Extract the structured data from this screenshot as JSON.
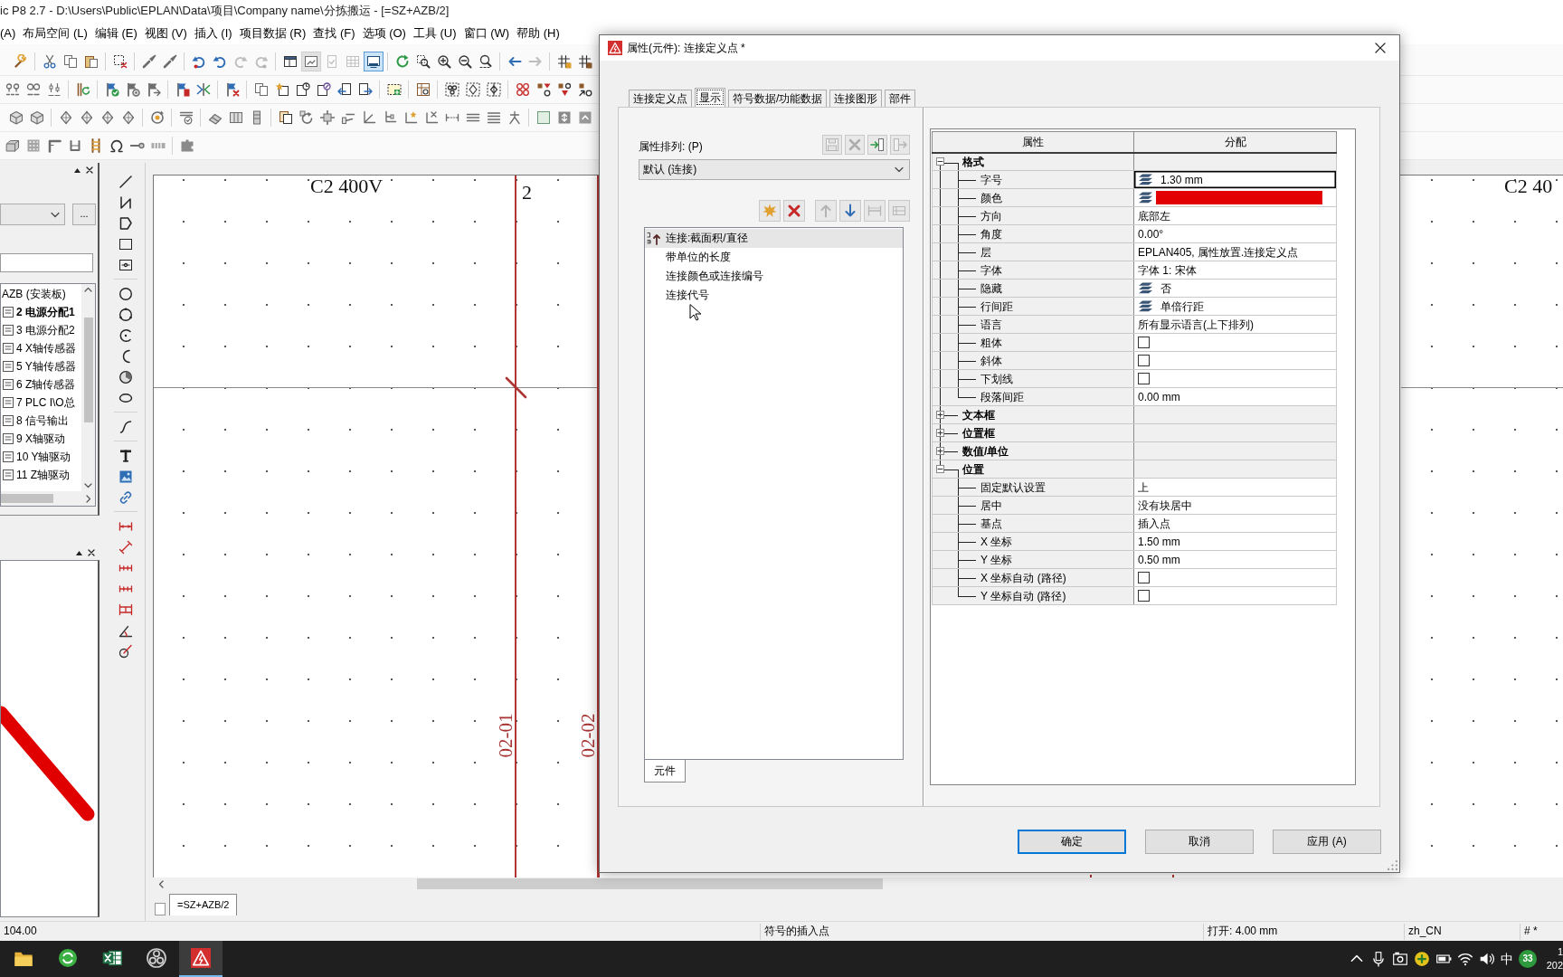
{
  "window": {
    "title": "ic P8 2.7 - D:\\Users\\Public\\EPLAN\\Data\\项目\\Company name\\分拣搬运 - [=SZ+AZB/2]"
  },
  "menu": [
    "(A)",
    "布局空间 (L)",
    "编辑 (E)",
    "视图 (V)",
    "插入 (I)",
    "项目数据 (R)",
    "查找 (F)",
    "选项 (O)",
    "工具 (U)",
    "窗口 (W)",
    "帮助 (H)"
  ],
  "toolbars": [
    [
      [
        {
          "kind": "wrench"
        }
      ],
      [
        {
          "kind": "scissors"
        },
        {
          "kind": "copy"
        },
        {
          "kind": "paste"
        }
      ],
      [
        {
          "kind": "deselect"
        }
      ],
      [
        {
          "kind": "brush"
        },
        {
          "kind": "brush"
        }
      ],
      [
        {
          "kind": "undomark",
          "disabled": false
        },
        {
          "kind": "undo",
          "disabled": false
        },
        {
          "kind": "redo",
          "disabled": true
        },
        {
          "kind": "redomark",
          "disabled": true
        }
      ],
      [
        {
          "kind": "layout",
          "disabled": false,
          "pressed": false,
          "hovered": false
        },
        {
          "kind": "view",
          "disabled": false,
          "pressed": false,
          "hovered": true
        },
        {
          "kind": "checkdoc",
          "disabled": true,
          "pressed": false,
          "hovered": false
        },
        {
          "kind": "table",
          "disabled": true,
          "pressed": false,
          "hovered": false
        },
        {
          "kind": "monitor",
          "disabled": false,
          "pressed": true,
          "hovered": false
        }
      ],
      [
        {
          "kind": "refresh"
        },
        {
          "kind": "zoomwindow"
        },
        {
          "kind": "zoomin"
        },
        {
          "kind": "zoomout"
        },
        {
          "kind": "zoomfit"
        }
      ],
      [
        {
          "kind": "back",
          "disabled": false
        },
        {
          "kind": "forward",
          "disabled": true
        }
      ],
      [
        {
          "kind": "hasha"
        },
        {
          "kind": "hashb"
        }
      ]
    ],
    [
      [
        {
          "kind": "numbering"
        },
        {
          "kind": "numbering2"
        },
        {
          "kind": "numbering3"
        }
      ],
      [
        {
          "kind": "barsync"
        }
      ],
      [
        {
          "kind": "flagcheck"
        },
        {
          "kind": "flaggear"
        },
        {
          "kind": "flagarrow"
        }
      ],
      [
        {
          "kind": "flagbook"
        },
        {
          "kind": "merge"
        }
      ],
      [
        {
          "kind": "flagx"
        }
      ],
      [
        {
          "kind": "pages"
        },
        {
          "kind": "pagestar"
        },
        {
          "kind": "pageclock"
        },
        {
          "kind": "pageout"
        },
        {
          "kind": "pageleft"
        },
        {
          "kind": "pageright"
        }
      ],
      [
        {
          "kind": "boxplus"
        }
      ],
      [
        {
          "kind": "gridsym"
        }
      ],
      [
        {
          "kind": "dashcircles"
        },
        {
          "kind": "dashdiamond"
        },
        {
          "kind": "dashnode"
        }
      ],
      [
        {
          "kind": "chains"
        },
        {
          "kind": "filter"
        },
        {
          "kind": "filter2"
        },
        {
          "kind": "filter3"
        }
      ]
    ],
    [
      [
        {
          "kind": "cube"
        },
        {
          "kind": "cube"
        }
      ],
      [
        {
          "kind": "gem"
        },
        {
          "kind": "gem"
        },
        {
          "kind": "gem"
        },
        {
          "kind": "gem"
        }
      ],
      [
        {
          "kind": "rotate"
        }
      ],
      [
        {
          "kind": "stackcheck"
        }
      ],
      [
        {
          "kind": "eraser"
        },
        {
          "kind": "columns"
        },
        {
          "kind": "column"
        }
      ],
      [
        {
          "kind": "docstack"
        },
        {
          "kind": "rotatearrow"
        },
        {
          "kind": "gearsq"
        },
        {
          "kind": "slant"
        },
        {
          "kind": "angle"
        },
        {
          "kind": "angle2"
        },
        {
          "kind": "starangle"
        },
        {
          "kind": "xangle"
        },
        {
          "kind": "dimline"
        },
        {
          "kind": "lines3"
        },
        {
          "kind": "lines4"
        },
        {
          "kind": "junction"
        }
      ],
      [
        {
          "kind": "squaregreen"
        },
        {
          "kind": "squarearrows"
        },
        {
          "kind": "squaregray"
        }
      ]
    ],
    [
      [
        {
          "kind": "block"
        },
        {
          "kind": "dotgrid"
        },
        {
          "kind": "corner"
        },
        {
          "kind": "ushape"
        },
        {
          "kind": "ladder"
        },
        {
          "kind": "omega"
        },
        {
          "kind": "terminal"
        },
        {
          "kind": "stripe"
        }
      ],
      [
        {
          "kind": "puzzle"
        }
      ]
    ]
  ],
  "navigator": {
    "more_button": "...",
    "tree": [
      {
        "label": "AZB (安装板)",
        "selected": false,
        "children": [
          {
            "label": "2 电源分配1",
            "selected": true
          },
          {
            "label": "3 电源分配2",
            "selected": false
          },
          {
            "label": "4 X轴传感器",
            "selected": false
          },
          {
            "label": "5 Y轴传感器",
            "selected": false
          },
          {
            "label": "6 Z轴传感器",
            "selected": false
          },
          {
            "label": "7 PLC I\\O总",
            "selected": false
          },
          {
            "label": "8 信号输出",
            "selected": false
          },
          {
            "label": "9 X轴驱动",
            "selected": false
          },
          {
            "label": "10 Y轴驱动",
            "selected": false
          },
          {
            "label": "11 Z轴驱动",
            "selected": false
          }
        ]
      }
    ]
  },
  "draw_toolbar": [
    [
      {
        "kind": "line"
      },
      {
        "kind": "polyline"
      },
      {
        "kind": "polygon"
      },
      {
        "kind": "rect"
      },
      {
        "kind": "framerect"
      }
    ],
    [
      {
        "kind": "circle"
      },
      {
        "kind": "circle3"
      },
      {
        "kind": "arc"
      },
      {
        "kind": "arc2"
      },
      {
        "kind": "sector"
      },
      {
        "kind": "ellipse"
      }
    ],
    [
      {
        "kind": "spline"
      }
    ],
    [
      {
        "kind": "text"
      },
      {
        "kind": "image"
      },
      {
        "kind": "link"
      }
    ],
    [
      {
        "kind": "dim"
      },
      {
        "kind": "dimdiag"
      },
      {
        "kind": "dimchain"
      },
      {
        "kind": "dimchain"
      },
      {
        "kind": "dimbase"
      },
      {
        "kind": "angledim"
      },
      {
        "kind": "radius"
      }
    ]
  ],
  "schematic": {
    "header_left": "C2 400V",
    "column_number": "2",
    "wire_labels": [
      "02-01",
      "02-02"
    ],
    "header_right": "C2 40"
  },
  "document_tab": "=SZ+AZB/2",
  "status_bar": [
    "104.00",
    "符号的插入点",
    "打开: 4.00 mm",
    "zh_CN",
    "# *"
  ],
  "taskbar": {
    "apps": [
      {
        "kind": "folder",
        "selected": false
      },
      {
        "kind": "sync",
        "selected": false
      },
      {
        "kind": "sheet",
        "selected": false
      },
      {
        "kind": "aperture",
        "selected": false
      },
      {
        "kind": "eplan",
        "selected": true
      }
    ],
    "ime": "中",
    "badge": "33",
    "clock": [
      "1",
      "202"
    ]
  },
  "dialog": {
    "title": "属性(元件): 连接定义点 *",
    "tabs": [
      {
        "label": "连接定义点",
        "selected": false
      },
      {
        "label": "显示",
        "selected": true
      },
      {
        "label": "符号数据/功能数据",
        "selected": false
      },
      {
        "label": "连接图形",
        "selected": false
      },
      {
        "label": "部件",
        "selected": false
      }
    ],
    "arrangement": {
      "label": "属性排列: (P)",
      "value": "默认 (连接)",
      "tools": [
        {
          "kind": "save",
          "disabled": true
        },
        {
          "kind": "delete",
          "disabled": true
        },
        {
          "kind": "import",
          "disabled": false
        },
        {
          "kind": "export",
          "disabled": true
        }
      ]
    },
    "list_tools": [
      [
        {
          "kind": "new"
        },
        {
          "kind": "remove"
        }
      ],
      [
        {
          "kind": "up",
          "disabled": true
        },
        {
          "kind": "down",
          "disabled": false
        },
        {
          "kind": "gap",
          "disabled": true
        },
        {
          "kind": "split",
          "disabled": true
        }
      ]
    ],
    "property_list": [
      {
        "label": "连接:截面积/直径",
        "sorted": true,
        "selected": true
      },
      {
        "label": "带单位的长度",
        "sorted": false,
        "selected": false
      },
      {
        "label": "连接颜色或连接编号",
        "sorted": false,
        "selected": false
      },
      {
        "label": "连接代号",
        "sorted": false,
        "selected": false
      }
    ],
    "list_tab": "元件",
    "grid": {
      "columns": [
        "属性",
        "分配"
      ],
      "groups": [
        {
          "label": "格式",
          "expanded": true,
          "children": [
            {
              "label": "字号",
              "kind": "text",
              "value": "1.30 mm",
              "layered": true,
              "selected": true
            },
            {
              "label": "颜色",
              "kind": "color",
              "color": "#e30000",
              "layered": true,
              "selected": false
            },
            {
              "label": "方向",
              "kind": "text",
              "value": "底部左",
              "layered": false,
              "selected": false
            },
            {
              "label": "角度",
              "kind": "text",
              "value": "0.00°",
              "layered": false,
              "selected": false
            },
            {
              "label": "层",
              "kind": "text",
              "value": "EPLAN405, 属性放置.连接定义点",
              "layered": false,
              "selected": false
            },
            {
              "label": "字体",
              "kind": "text",
              "value": "字体 1: 宋体",
              "layered": false,
              "selected": false
            },
            {
              "label": "隐藏",
              "kind": "text",
              "value": "否",
              "layered": true,
              "selected": false
            },
            {
              "label": "行间距",
              "kind": "text",
              "value": "单倍行距",
              "layered": true,
              "selected": false
            },
            {
              "label": "语言",
              "kind": "text",
              "value": "所有显示语言(上下排列)",
              "layered": false,
              "selected": false
            },
            {
              "label": "粗体",
              "kind": "checkbox",
              "checked": false,
              "layered": false,
              "selected": false
            },
            {
              "label": "斜体",
              "kind": "checkbox",
              "checked": false,
              "layered": false,
              "selected": false
            },
            {
              "label": "下划线",
              "kind": "checkbox",
              "checked": false,
              "layered": false,
              "selected": false
            },
            {
              "label": "段落间距",
              "kind": "text",
              "value": "0.00 mm",
              "layered": false,
              "selected": false
            }
          ]
        },
        {
          "label": "文本框",
          "expanded": false
        },
        {
          "label": "位置框",
          "expanded": false
        },
        {
          "label": "数值/单位",
          "expanded": false
        },
        {
          "label": "位置",
          "expanded": true,
          "children": [
            {
              "label": "固定默认设置",
              "kind": "text",
              "value": "上",
              "layered": false,
              "selected": false
            },
            {
              "label": "居中",
              "kind": "text",
              "value": "没有块居中",
              "layered": false,
              "selected": false
            },
            {
              "label": "基点",
              "kind": "text",
              "value": "插入点",
              "layered": false,
              "selected": false
            },
            {
              "label": "X 坐标",
              "kind": "text",
              "value": "1.50 mm",
              "layered": false,
              "selected": false
            },
            {
              "label": "Y 坐标",
              "kind": "text",
              "value": "0.50 mm",
              "layered": false,
              "selected": false
            },
            {
              "label": "X 坐标自动 (路径)",
              "kind": "checkbox",
              "checked": false,
              "layered": false,
              "selected": false
            },
            {
              "label": "Y 坐标自动 (路径)",
              "kind": "checkbox",
              "checked": false,
              "layered": false,
              "selected": false
            }
          ]
        }
      ]
    },
    "buttons": [
      {
        "label": "确定",
        "default": true
      },
      {
        "label": "取消",
        "default": false
      },
      {
        "label": "应用 (A)",
        "default": false
      }
    ]
  }
}
